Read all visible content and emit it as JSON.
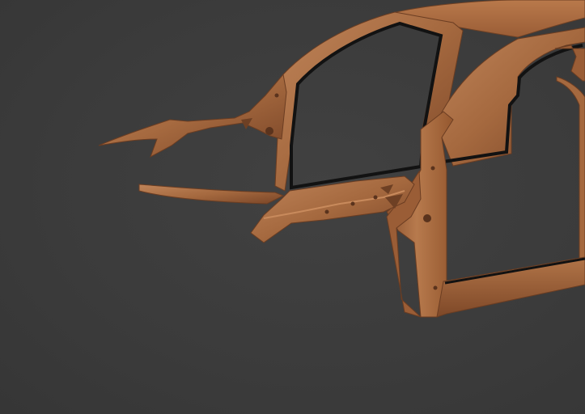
{
  "viewport": {
    "background_color": "#3c3c3c",
    "model_color": "#a5693f",
    "model_highlight": "#c88a5c",
    "model_shadow": "#6e4024",
    "glass_edge_color": "#121212"
  },
  "model": {
    "icon": "car-body-frame-model"
  }
}
